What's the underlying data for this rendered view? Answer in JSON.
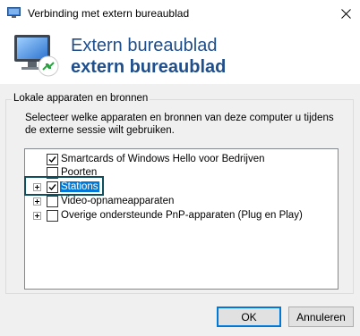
{
  "window": {
    "title": "Verbinding met extern bureaublad",
    "close_icon": "close-icon"
  },
  "header": {
    "icon": "remote-desktop-icon",
    "line1": "Extern bureaublad",
    "line2": "extern bureaublad",
    "color": "#1f4e8c"
  },
  "group": {
    "label": "Lokale apparaten en bronnen",
    "description": "Selecteer welke apparaten en bronnen van deze computer u tijdens de externe sessie wilt gebruiken."
  },
  "tree": {
    "items": [
      {
        "label": "Smartcards of Windows Hello voor Bedrijven",
        "checked": true,
        "expandable": false,
        "selected": false
      },
      {
        "label": "Poorten",
        "checked": false,
        "expandable": false,
        "selected": false
      },
      {
        "label": "Stations",
        "checked": true,
        "expandable": true,
        "selected": true
      },
      {
        "label": "Video-opnameapparaten",
        "checked": false,
        "expandable": true,
        "selected": false
      },
      {
        "label": "Overige ondersteunde PnP-apparaten (Plug en Play)",
        "checked": false,
        "expandable": true,
        "selected": false
      }
    ]
  },
  "buttons": {
    "ok": "OK",
    "cancel": "Annuleren"
  },
  "colors": {
    "selection": "#0078d7",
    "highlight_outline": "#0f4e5c"
  }
}
